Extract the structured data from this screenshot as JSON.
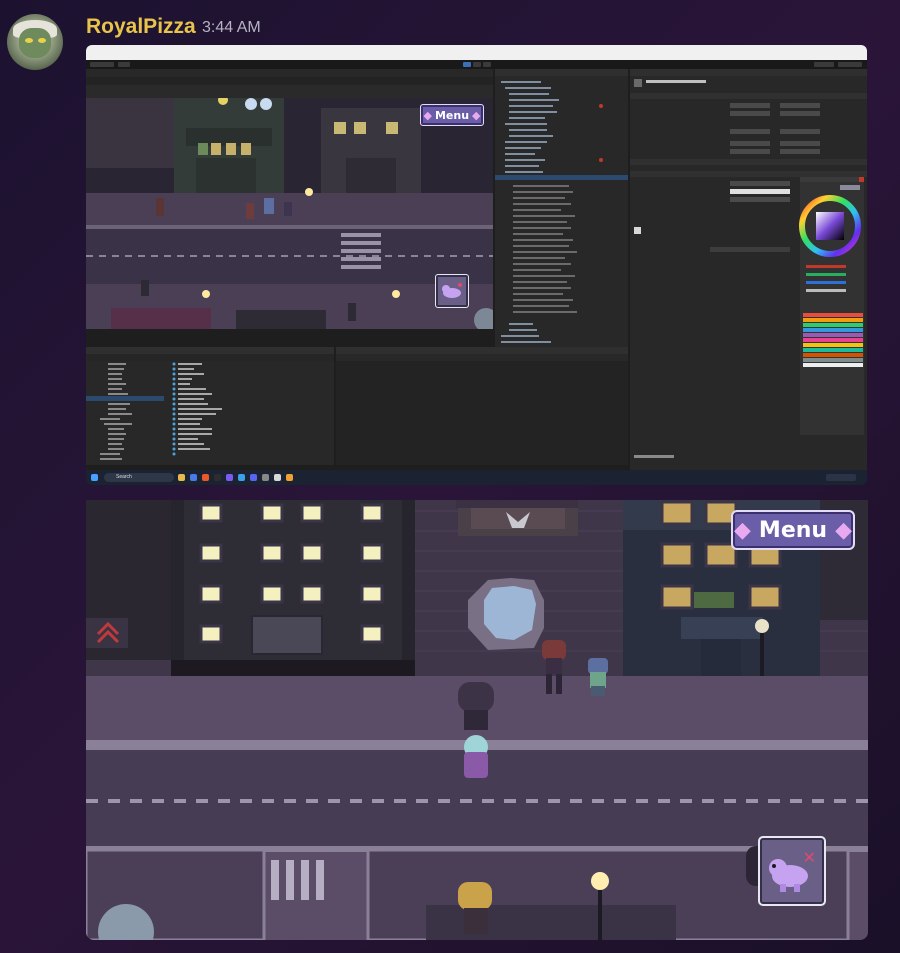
{
  "message": {
    "username": "RoyalPizza",
    "timestamp": "3:44 AM",
    "username_color": "#e9c44a"
  },
  "game": {
    "menu_label": "Menu",
    "menu_gem": "◆",
    "pet_icon": "pet-icon",
    "close_mark": "✕"
  },
  "taskbar": {
    "search_placeholder": "Search"
  }
}
